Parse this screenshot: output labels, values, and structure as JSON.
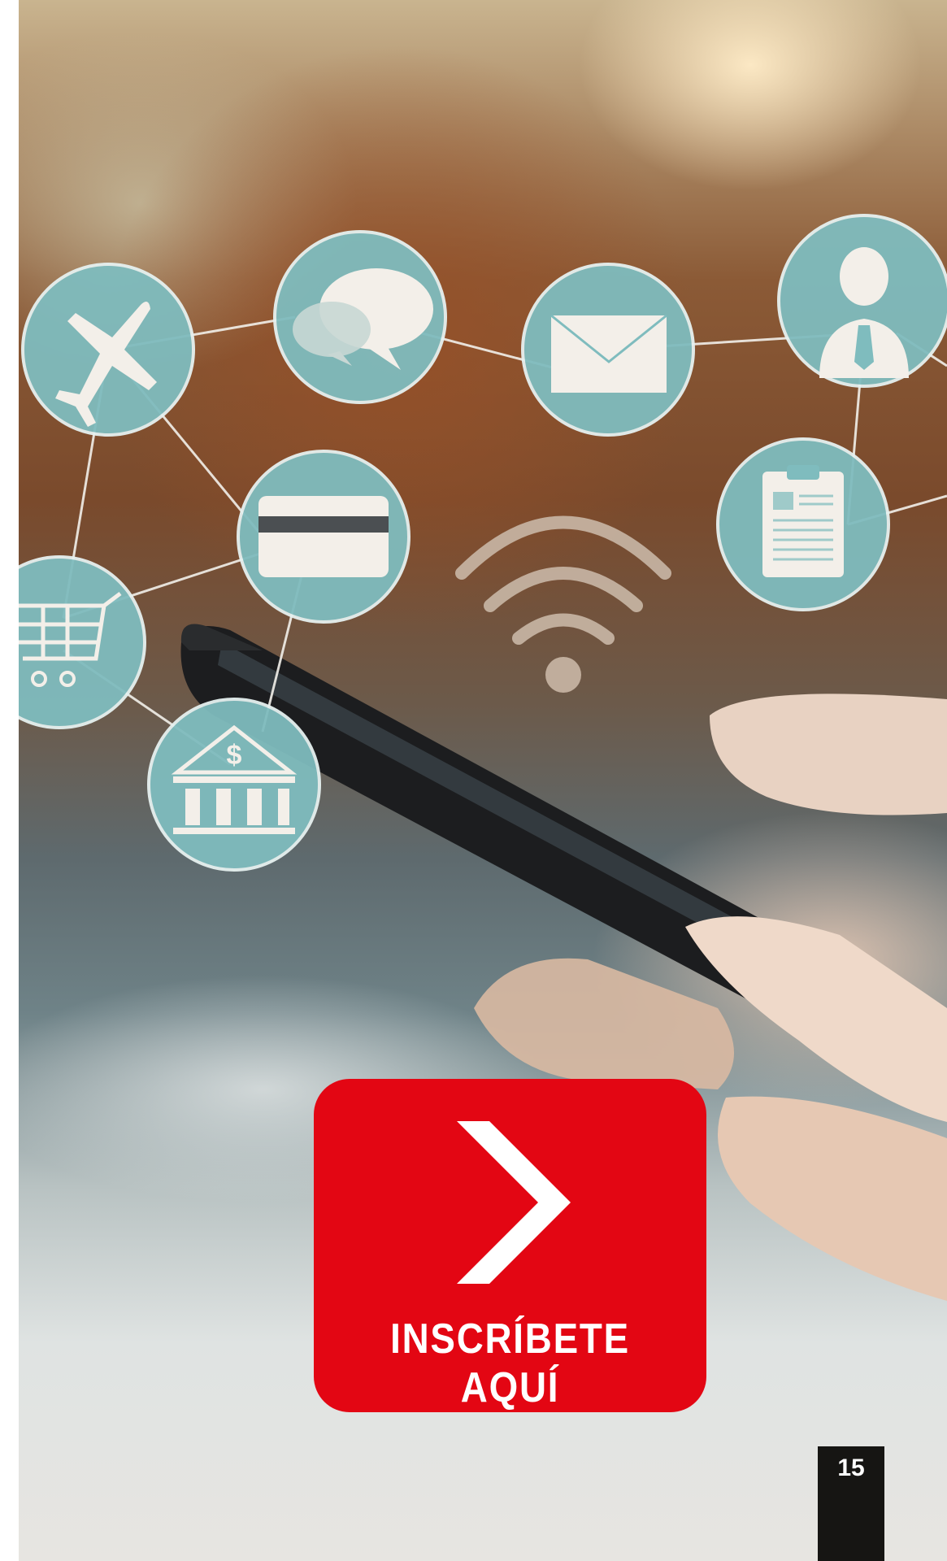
{
  "cta": {
    "label": "INSCRÍBETE AQUÍ",
    "icon": "chevron-right-icon",
    "background_color": "#e30613",
    "text_color": "#ffffff"
  },
  "page": {
    "number": "15"
  },
  "network_icons": [
    "airplane-icon",
    "chat-bubbles-icon",
    "envelope-icon",
    "businessman-icon",
    "credit-card-icon",
    "clipboard-document-icon",
    "shopping-cart-icon",
    "bank-icon",
    "wifi-icon"
  ],
  "colors": {
    "icon_circle": "#7fbcbe",
    "icon_glyph": "#f3efe9"
  }
}
